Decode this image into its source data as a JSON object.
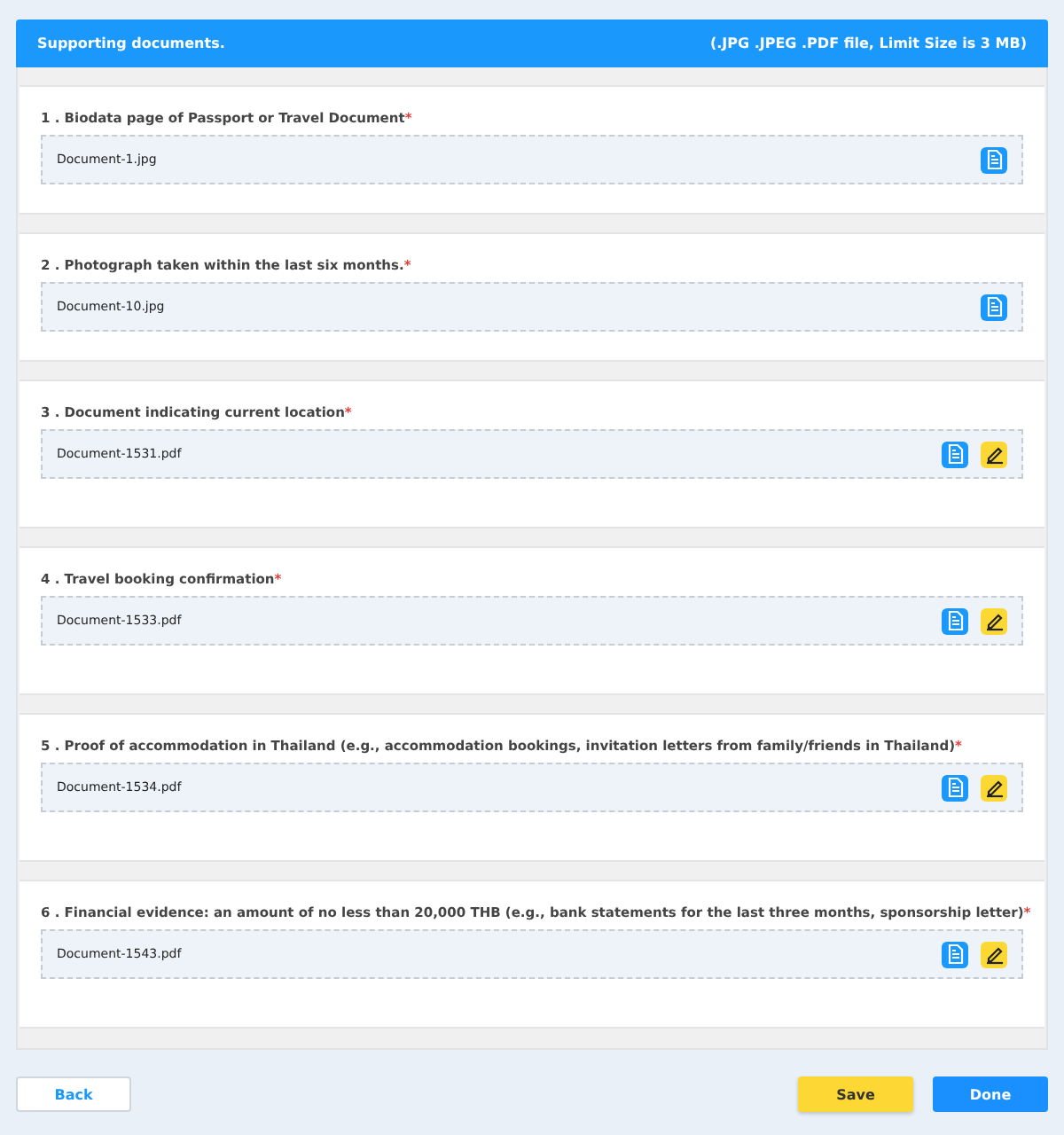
{
  "header": {
    "title": "Supporting documents.",
    "note": "(.JPG .JPEG .PDF file, Limit Size is 3 MB)"
  },
  "documents": [
    {
      "label": "1 . Biodata page of Passport or Travel Document",
      "required": true,
      "file": "Document-1.jpg",
      "editable": false
    },
    {
      "label": "2 . Photograph taken within the last six months.",
      "required": true,
      "file": "Document-10.jpg",
      "editable": false
    },
    {
      "label": "3 . Document indicating current location",
      "required": true,
      "file": "Document-1531.pdf",
      "editable": true
    },
    {
      "label": "4 . Travel booking confirmation",
      "required": true,
      "file": "Document-1533.pdf",
      "editable": true
    },
    {
      "label": "5 . Proof of accommodation in Thailand (e.g., accommodation bookings, invitation letters from family/friends in Thailand)",
      "required": true,
      "file": "Document-1534.pdf",
      "editable": true
    },
    {
      "label": "6 . Financial evidence: an amount of no less than 20,000 THB (e.g., bank statements for the last three months, sponsorship letter)",
      "required": true,
      "file": "Document-1543.pdf",
      "editable": true
    }
  ],
  "buttons": {
    "back": "Back",
    "save": "Save",
    "done": "Done"
  },
  "required_mark": "*"
}
